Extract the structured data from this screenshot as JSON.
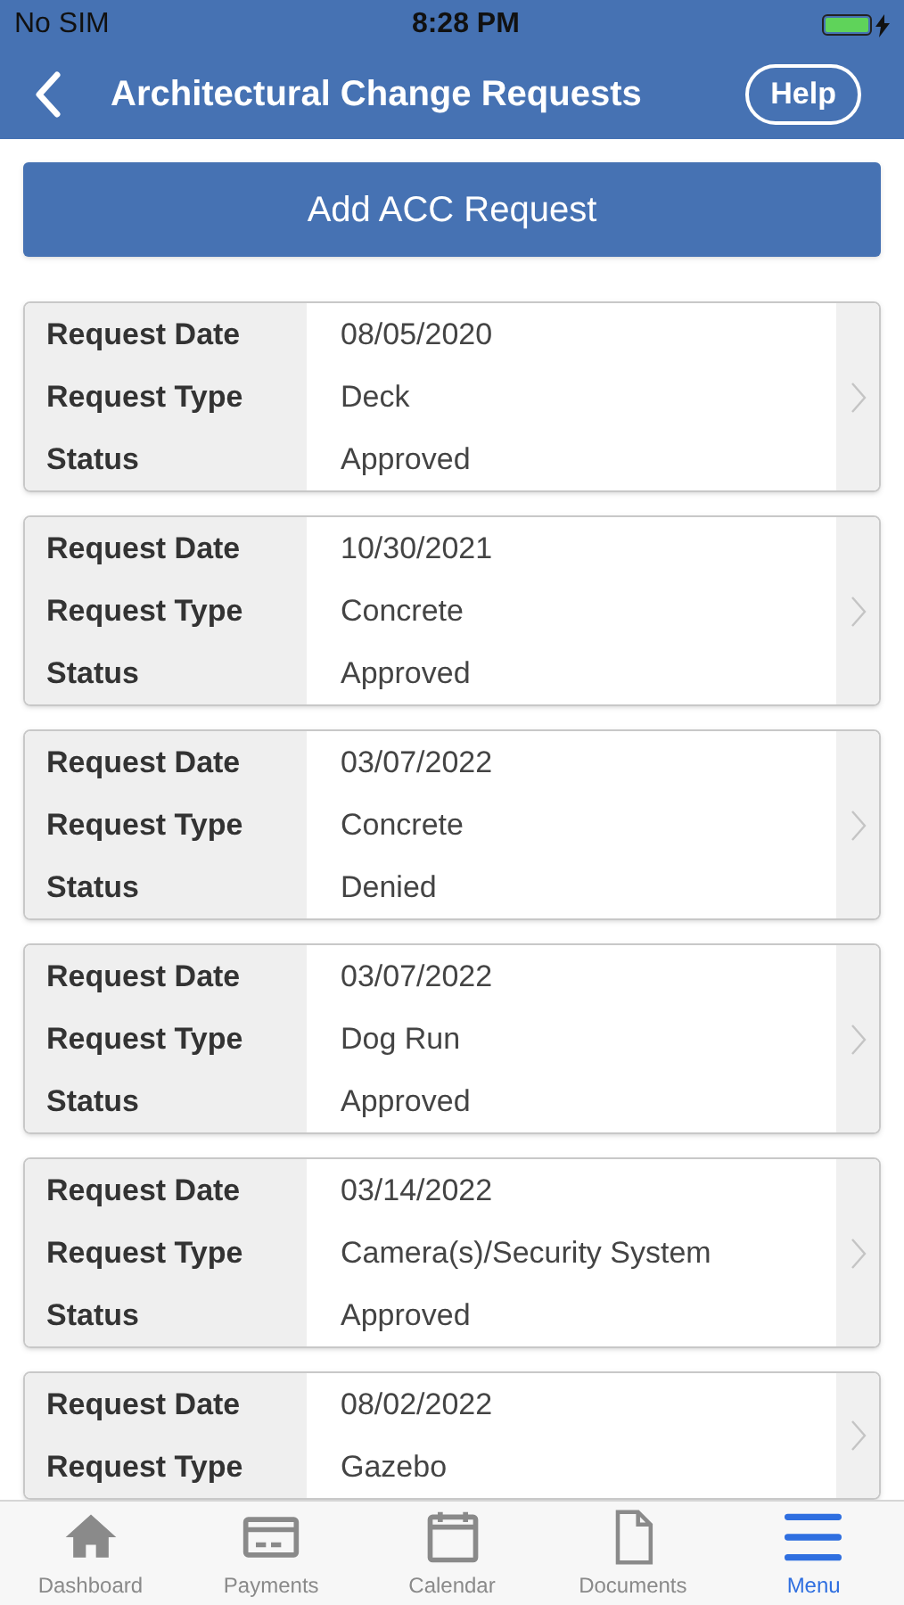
{
  "status_bar": {
    "carrier": "No SIM",
    "time": "8:28 PM"
  },
  "header": {
    "title": "Architectural Change Requests",
    "help_button": "Help"
  },
  "add_button": "Add ACC Request",
  "requests": [
    {
      "fields": [
        {
          "label": "Request Date",
          "value": "08/05/2020"
        },
        {
          "label": "Request Type",
          "value": "Deck"
        },
        {
          "label": "Status",
          "value": "Approved"
        }
      ]
    },
    {
      "fields": [
        {
          "label": "Request Date",
          "value": "10/30/2021"
        },
        {
          "label": "Request Type",
          "value": "Concrete"
        },
        {
          "label": "Status",
          "value": "Approved"
        }
      ]
    },
    {
      "fields": [
        {
          "label": "Request Date",
          "value": "03/07/2022"
        },
        {
          "label": "Request Type",
          "value": "Concrete"
        },
        {
          "label": "Status",
          "value": "Denied"
        }
      ]
    },
    {
      "fields": [
        {
          "label": "Request Date",
          "value": "03/07/2022"
        },
        {
          "label": "Request Type",
          "value": "Dog Run"
        },
        {
          "label": "Status",
          "value": "Approved"
        }
      ]
    },
    {
      "fields": [
        {
          "label": "Request Date",
          "value": "03/14/2022"
        },
        {
          "label": "Request Type",
          "value": "Camera(s)/Security System"
        },
        {
          "label": "Status",
          "value": "Approved"
        }
      ]
    },
    {
      "fields": [
        {
          "label": "Request Date",
          "value": "08/02/2022"
        },
        {
          "label": "Request Type",
          "value": "Gazebo"
        }
      ]
    }
  ],
  "tab_bar": [
    {
      "kind": "home",
      "label": "Dashboard",
      "selected": false
    },
    {
      "kind": "card",
      "label": "Payments",
      "selected": false
    },
    {
      "kind": "calendar",
      "label": "Calendar",
      "selected": false
    },
    {
      "kind": "document",
      "label": "Documents",
      "selected": false
    },
    {
      "kind": "menu",
      "label": "Menu",
      "selected": true
    }
  ]
}
